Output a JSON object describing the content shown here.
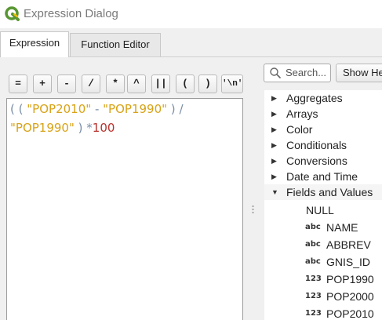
{
  "window": {
    "title": "Expression Dialog"
  },
  "tabs": [
    {
      "label": "Expression"
    },
    {
      "label": "Function Editor"
    }
  ],
  "operators": [
    "=",
    "+",
    "-",
    "/",
    "*",
    "^",
    "||",
    "(",
    ")",
    "'\\n'"
  ],
  "editor": {
    "line1": {
      "open1": "(",
      "open2": "(",
      "field1": "\"POP2010\"",
      "minus": "-",
      "field2": "\"POP1990\"",
      "close1": ")",
      "div": "/"
    },
    "line2": {
      "field3": "\"POP1990\"",
      "close2": ")",
      "mult": "*",
      "num": "100"
    }
  },
  "search": {
    "placeholder": "Search..."
  },
  "show_help_label": "Show Help",
  "tree": {
    "groups": [
      {
        "label": "Aggregates",
        "expanded": false
      },
      {
        "label": "Arrays",
        "expanded": false
      },
      {
        "label": "Color",
        "expanded": false
      },
      {
        "label": "Conditionals",
        "expanded": false
      },
      {
        "label": "Conversions",
        "expanded": false
      },
      {
        "label": "Date and Time",
        "expanded": false
      },
      {
        "label": "Fields and Values",
        "expanded": true
      }
    ],
    "null_label": "NULL",
    "fields": [
      {
        "type": "abc",
        "name": "NAME"
      },
      {
        "type": "abc",
        "name": "ABBREV"
      },
      {
        "type": "abc",
        "name": "GNIS_ID"
      },
      {
        "type": "123",
        "name": "POP1990"
      },
      {
        "type": "123",
        "name": "POP2000"
      },
      {
        "type": "123",
        "name": "POP2010"
      }
    ]
  },
  "colors": {
    "field": "#d8a317",
    "operator": "#7a8ea8",
    "number": "#b8332e",
    "qgis_green": "#589632",
    "qgis_yellow": "#eebe0b"
  }
}
